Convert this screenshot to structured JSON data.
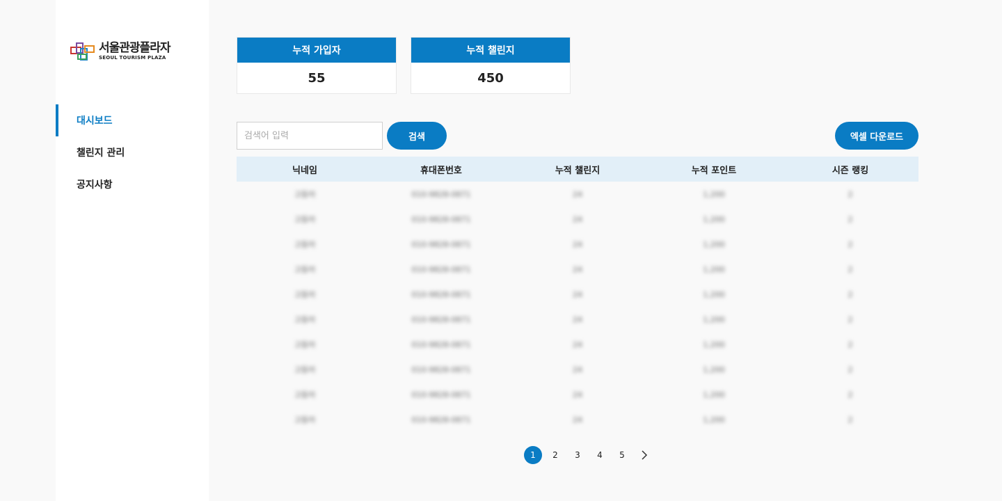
{
  "brand": {
    "name_ko": "서울관광플라자",
    "name_en": "SEOUL TOURISM PLAZA"
  },
  "sidebar": {
    "items": [
      {
        "label": "대시보드",
        "active": true
      },
      {
        "label": "챌린지 관리",
        "active": false
      },
      {
        "label": "공지사항",
        "active": false
      }
    ]
  },
  "stats": [
    {
      "label": "누적 가입자",
      "value": "55"
    },
    {
      "label": "누적 챌린지",
      "value": "450"
    }
  ],
  "search": {
    "placeholder": "검색어 입력",
    "button_label": "검색"
  },
  "excel_button_label": "엑셀 다운로드",
  "table": {
    "columns": [
      "닉네임",
      "휴대폰번호",
      "누적 챌린지",
      "누적 포인트",
      "시즌 랭킹"
    ],
    "rows": [
      [
        "고등어",
        "010-9828-0871",
        "24",
        "1,200",
        "2"
      ],
      [
        "고등어",
        "010-9828-0871",
        "24",
        "1,200",
        "2"
      ],
      [
        "고등어",
        "010-9828-0871",
        "24",
        "1,200",
        "2"
      ],
      [
        "고등어",
        "010-9828-0871",
        "24",
        "1,200",
        "2"
      ],
      [
        "고등어",
        "010-9828-0871",
        "24",
        "1,200",
        "2"
      ],
      [
        "고등어",
        "010-9828-0871",
        "24",
        "1,200",
        "2"
      ],
      [
        "고등어",
        "010-9828-0871",
        "24",
        "1,200",
        "2"
      ],
      [
        "고등어",
        "010-9828-0871",
        "24",
        "1,200",
        "2"
      ],
      [
        "고등어",
        "010-9828-0871",
        "24",
        "1,200",
        "2"
      ],
      [
        "고등어",
        "010-9828-0871",
        "24",
        "1,200",
        "2"
      ]
    ]
  },
  "pagination": {
    "pages": [
      "1",
      "2",
      "3",
      "4",
      "5"
    ],
    "current": "1",
    "next_icon": "chevron-right-icon"
  },
  "colors": {
    "accent": "#0a7cc4",
    "table_header_bg": "#e2eff8",
    "page_bg": "#f9f9f9"
  }
}
